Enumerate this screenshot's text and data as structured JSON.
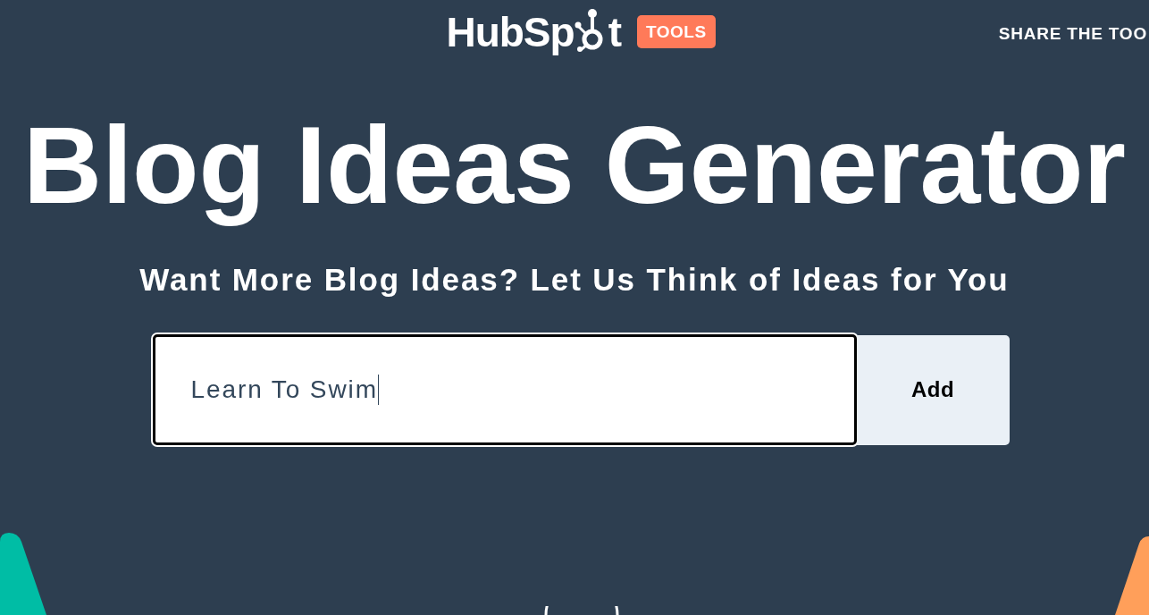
{
  "header": {
    "logo": {
      "text_start": "HubSp",
      "text_end": "t",
      "badge": "TOOLS"
    },
    "share_link": "SHARE THE TOO"
  },
  "hero": {
    "title": "Blog Ideas Generator",
    "subtitle": "Want More Blog Ideas? Let Us Think of Ideas for You"
  },
  "form": {
    "input": {
      "value": "Learn To Swim",
      "focused": true
    },
    "button": "Add"
  }
}
